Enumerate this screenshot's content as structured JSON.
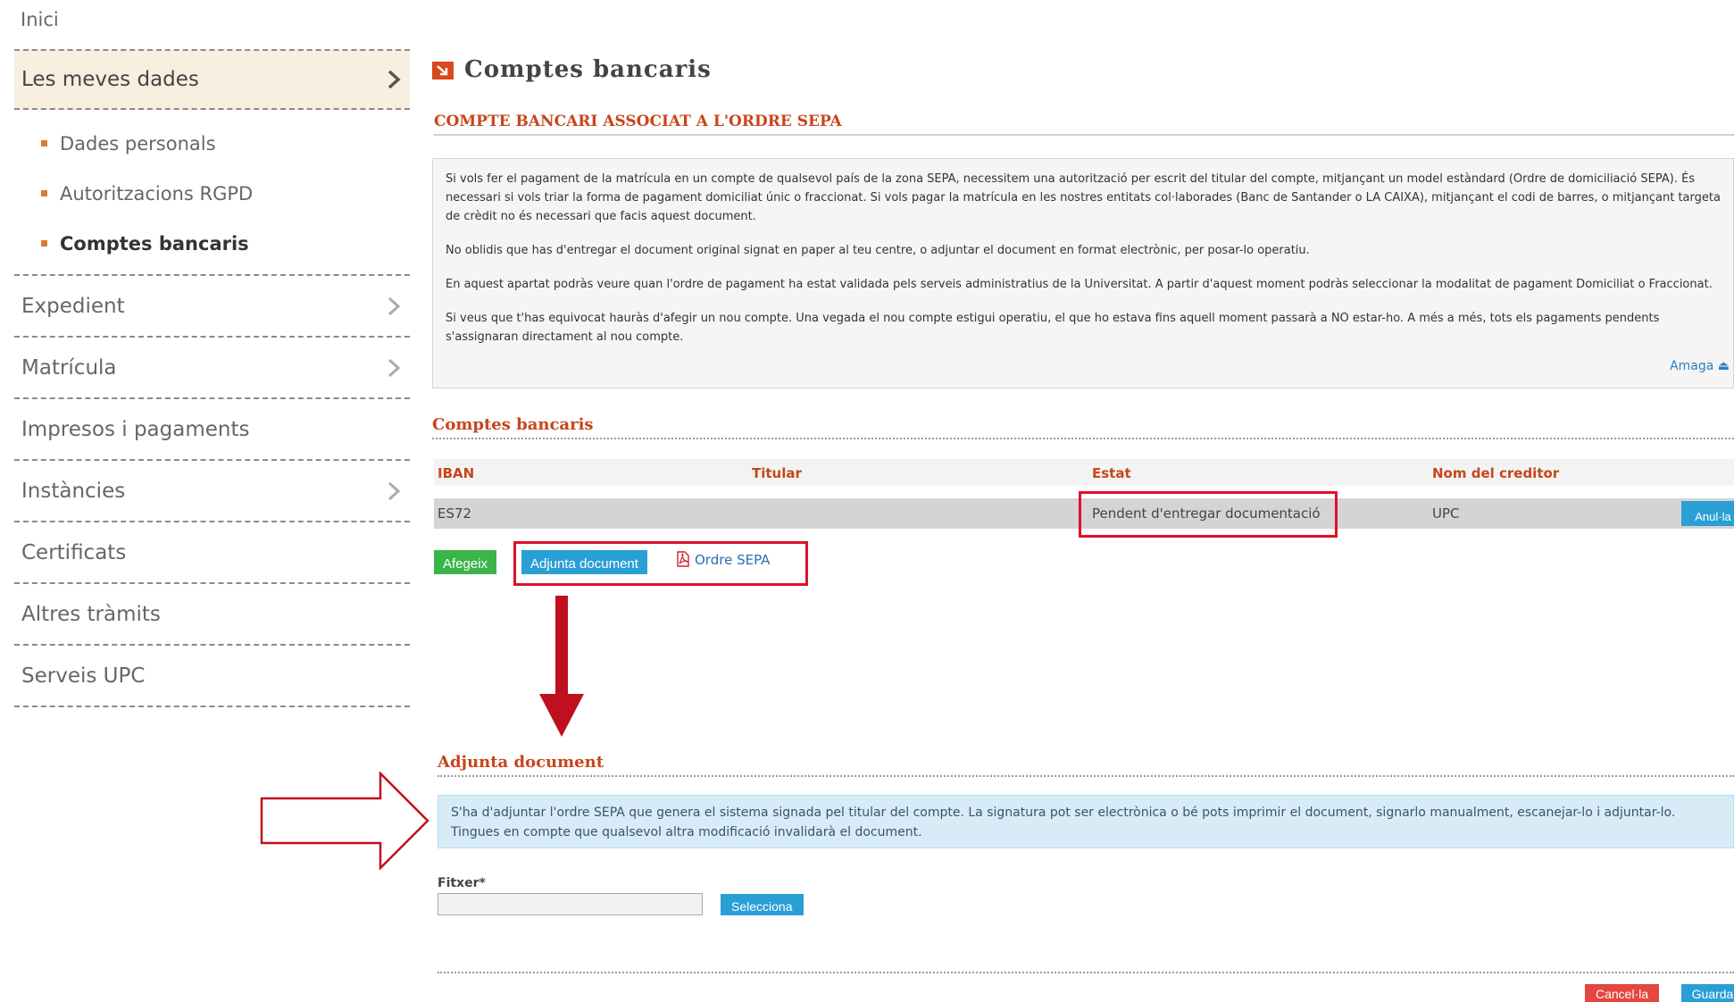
{
  "nav": {
    "home": "Inici",
    "items": [
      {
        "label": "Les meves dades"
      },
      {
        "label": "Expedient"
      },
      {
        "label": "Matrícula"
      },
      {
        "label": "Impresos i pagaments"
      },
      {
        "label": "Instàncies"
      },
      {
        "label": "Certificats"
      },
      {
        "label": "Altres tràmits"
      },
      {
        "label": "Serveis UPC"
      }
    ],
    "subitems": [
      {
        "label": "Dades personals"
      },
      {
        "label": "Autoritzacions RGPD"
      },
      {
        "label": "Comptes bancaris"
      }
    ]
  },
  "page": {
    "title": "Comptes bancaris",
    "section_title": "COMPTE BANCARI ASSOCIAT A L'ORDRE SEPA"
  },
  "info": {
    "p1": "Si vols fer el pagament de la matrícula en un compte de qualsevol país de la zona SEPA, necessitem una autorització per escrit del titular del compte, mitjançant un model estàndard (Ordre de domiciliació SEPA). És necessari si vols triar la forma de pagament domiciliat únic o fraccionat. Si vols pagar la matrícula en les nostres entitats col·laborades (Banc de Santander o LA CAIXA), mitjançant el codi de barres, o mitjançant targeta de crèdit no és necessari que facis aquest document.",
    "p2": "No oblidis que has d'entregar el document original signat en paper al teu centre, o adjuntar el document en format electrònic, per posar-lo operatiu.",
    "p3": "En aquest apartat podràs veure quan l'ordre de pagament ha estat validada pels serveis administratius de la Universitat. A partir d'aquest moment podràs seleccionar la modalitat de pagament Domiciliat o Fraccionat.",
    "p4": "Si veus que t'has equivocat hauràs d'afegir un nou compte. Una vegada el nou compte estigui operatiu, el que ho estava fins aquell moment passarà a NO estar-ho. A més a més, tots els pagaments pendents s'assignaran directament al nou compte.",
    "hide_link": "Amaga ⏏"
  },
  "accounts": {
    "title": "Comptes bancaris",
    "columns": [
      "IBAN",
      "Titular",
      "Estat",
      "Nom del creditor"
    ],
    "rows": [
      {
        "iban": "ES72",
        "titular": "",
        "estat": "Pendent d'entregar documentació",
        "creditor": "UPC",
        "action": "Anul·la"
      }
    ],
    "add_button": "Afegeix",
    "attach_button": "Adjunta document",
    "sepa_link": "Ordre SEPA"
  },
  "attach": {
    "title": "Adjunta document",
    "note": "S'ha d'adjuntar l'ordre SEPA que genera el sistema signada pel titular del compte. La signatura pot ser electrònica o bé pots imprimir el document, signarlo manualment, escanejar-lo i adjuntar-lo. Tingues en compte que qualsevol altra modificació invalidarà el document.",
    "field_label": "Fitxer*",
    "select_button": "Selecciona",
    "cancel_button": "Cancel·la",
    "save_button": "Guarda"
  },
  "colors": {
    "accent_orange": "#c8451a",
    "highlight_red": "#e0102a",
    "button_blue": "#2a9fd6",
    "button_green": "#3bb54a",
    "button_red": "#e5463f"
  }
}
